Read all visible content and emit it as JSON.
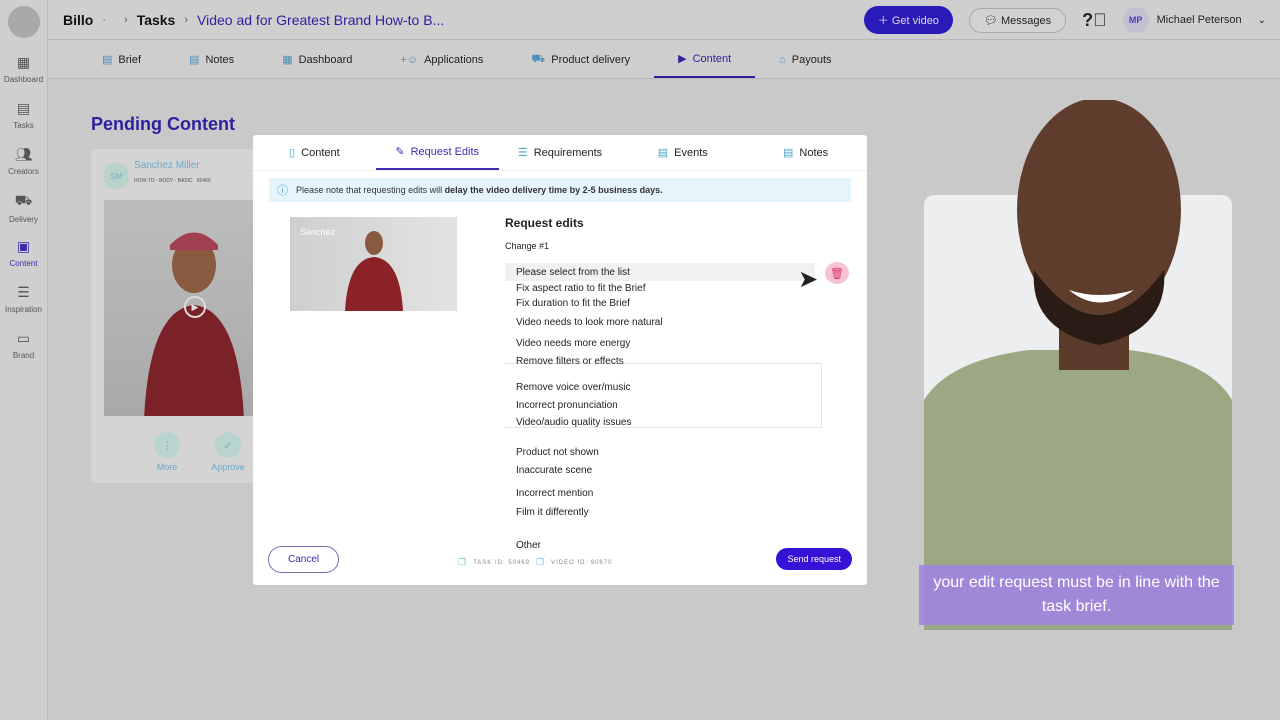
{
  "sidebar": {
    "items": [
      {
        "label": "Dashboard",
        "icon": "grid-icon"
      },
      {
        "label": "Tasks",
        "icon": "clipboard-icon"
      },
      {
        "label": "Creators",
        "icon": "users-icon"
      },
      {
        "label": "Delivery",
        "icon": "truck-icon"
      },
      {
        "label": "Content",
        "icon": "image-icon",
        "active": true
      },
      {
        "label": "Inspiration",
        "icon": "stack-icon"
      },
      {
        "label": "Brand",
        "icon": "briefcase-icon"
      }
    ]
  },
  "header": {
    "breadcrumb": [
      "Billo",
      "Tasks",
      "Video ad for Greatest Brand How-to B..."
    ],
    "get_video": "Get video",
    "messages": "Messages",
    "user_initials": "MP",
    "user_name": "Michael Peterson"
  },
  "tabs": [
    {
      "label": "Brief"
    },
    {
      "label": "Notes"
    },
    {
      "label": "Dashboard"
    },
    {
      "label": "Applications"
    },
    {
      "label": "Product delivery"
    },
    {
      "label": "Content",
      "active": true
    },
    {
      "label": "Payouts"
    }
  ],
  "page": {
    "title": "Pending Content"
  },
  "card": {
    "initials": "SM",
    "name": "Sanchez Miller",
    "tags": "HOW-TO - BODY - BASIC",
    "id": "50469",
    "more": "More",
    "approve": "Approve"
  },
  "modal": {
    "tabs": [
      {
        "label": "Content"
      },
      {
        "label": "Request Edits",
        "active": true
      },
      {
        "label": "Requirements"
      },
      {
        "label": "Events"
      },
      {
        "label": "Notes"
      }
    ],
    "notice_pre": "Please note that requesting edits will ",
    "notice_bold": "delay the video delivery time by 2-5 business days.",
    "thumb_label": "Sanchez",
    "heading": "Request edits",
    "change": "Change #1",
    "options": [
      "Please select from the list",
      "Fix aspect ratio to fit the Brief",
      "Fix duration to fit the Brief",
      "Video needs to look more natural",
      "Video needs more energy",
      "Remove filters or effects",
      "Remove voice over/music",
      "Incorrect pronunciation",
      "Video/audio quality issues",
      "Product not shown",
      "Inaccurate scene",
      "Incorrect mention",
      "Film it differently",
      "Other"
    ],
    "cancel": "Cancel",
    "task_id": "TASK ID: 50469",
    "video_id": "VIDEO ID: 90670",
    "send": "Send request"
  },
  "overlay": {
    "caption": "your edit request must be in line with the task brief."
  },
  "colors": {
    "accent": "#3612d6",
    "brand": "#2d1fa0",
    "delete": "#e0336a"
  }
}
